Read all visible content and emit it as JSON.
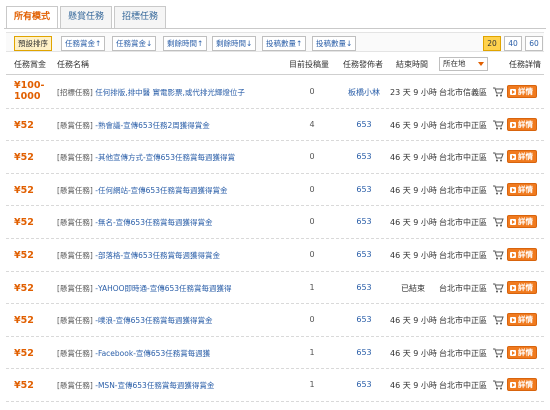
{
  "tabs": [
    {
      "label": "所有模式"
    },
    {
      "label": "懸賞任務"
    },
    {
      "label": "招標任務"
    }
  ],
  "toolbar": {
    "sort_buttons": [
      {
        "label": "預設排序"
      },
      {
        "label": "任務賞金↑"
      },
      {
        "label": "任務賞金↓"
      },
      {
        "label": "剩餘時間↑"
      },
      {
        "label": "剩餘時間↓"
      },
      {
        "label": "投稿數量↑"
      },
      {
        "label": "投稿數量↓"
      }
    ],
    "page_sizes": [
      {
        "label": "20"
      },
      {
        "label": "40"
      },
      {
        "label": "60"
      }
    ]
  },
  "header": {
    "amount": "任務賞金",
    "name": "任務名稱",
    "count": "目前投稿量",
    "issuer": "任務發佈者",
    "endtime": "結束時間",
    "location_select": "所在地",
    "detail": "任務詳情"
  },
  "rows": [
    {
      "amount": "¥100-1000",
      "cat": "[招標任務]",
      "title": "任何排版,排中醫 實電影票,或代排光輝燈位子",
      "count": "0",
      "issuer": "板橋小林",
      "endtime": "23 天 9 小時",
      "location": "台北市信義區",
      "detail": "詳情"
    },
    {
      "amount": "¥52",
      "cat": "[懸賞任務]",
      "title": "-熟會議-宣傳653任務2周獲得賞金",
      "count": "4",
      "issuer": "653",
      "endtime": "46 天 9 小時",
      "location": "台北市中正區",
      "detail": "詳情"
    },
    {
      "amount": "¥52",
      "cat": "[懸賞任務]",
      "title": "-其他宣傳方式-宣傳653任務賞每週獲得賞",
      "count": "0",
      "issuer": "653",
      "endtime": "46 天 9 小時",
      "location": "台北市中正區",
      "detail": "詳情"
    },
    {
      "amount": "¥52",
      "cat": "[懸賞任務]",
      "title": "-任何網站-宣傳653任務賞每週獲得賞金",
      "count": "0",
      "issuer": "653",
      "endtime": "46 天 9 小時",
      "location": "台北市中正區",
      "detail": "詳情"
    },
    {
      "amount": "¥52",
      "cat": "[懸賞任務]",
      "title": "-無名-宣傳653任務賞每週獲得賞金",
      "count": "0",
      "issuer": "653",
      "endtime": "46 天 9 小時",
      "location": "台北市中正區",
      "detail": "詳情"
    },
    {
      "amount": "¥52",
      "cat": "[懸賞任務]",
      "title": "-部落格-宣傳653任務賞每週獲得賞金",
      "count": "0",
      "issuer": "653",
      "endtime": "46 天 9 小時",
      "location": "台北市中正區",
      "detail": "詳情"
    },
    {
      "amount": "¥52",
      "cat": "[懸賞任務]",
      "title": "-YAHOO即時通-宣傳653任務賞每週獲得",
      "count": "1",
      "issuer": "653",
      "endtime": "已結束",
      "location": "台北市中正區",
      "detail": "詳情"
    },
    {
      "amount": "¥52",
      "cat": "[懸賞任務]",
      "title": "-噗浪-宣傳653任務賞每週獲得賞金",
      "count": "0",
      "issuer": "653",
      "endtime": "46 天 9 小時",
      "location": "台北市中正區",
      "detail": "詳情"
    },
    {
      "amount": "¥52",
      "cat": "[懸賞任務]",
      "title": "-Facebook-宣傳653任務賞每週獲",
      "count": "1",
      "issuer": "653",
      "endtime": "46 天 9 小時",
      "location": "台北市中正區",
      "detail": "詳情"
    },
    {
      "amount": "¥52",
      "cat": "[懸賞任務]",
      "title": "-MSN-宣傳653任務賞每週獲得賞金",
      "count": "1",
      "issuer": "653",
      "endtime": "46 天 9 小時",
      "location": "台北市中正區",
      "detail": "詳情"
    }
  ],
  "colors": {
    "accent": "#e15f00",
    "link": "#2a5ea8",
    "detail_button": "#f07a1e"
  }
}
